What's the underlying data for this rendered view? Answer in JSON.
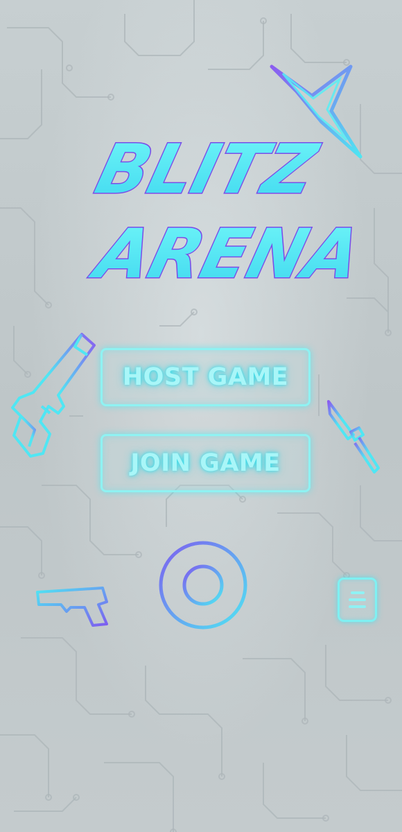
{
  "title": {
    "line1": "BLITZ",
    "line2": "ARENA"
  },
  "menu": {
    "host_label": "HOST GAME",
    "join_label": "JOIN GAME"
  },
  "icons": {
    "shuriken": "shuriken-icon",
    "pistol_large": "pistol-icon",
    "knife": "knife-icon",
    "crosshair": "crosshair-icon",
    "pistol_small": "pistol-icon",
    "menu": "menu-icon"
  },
  "colors": {
    "background": "#c2c9cb",
    "neon_cyan": "#5ff0f5",
    "neon_purple": "#8a5cf0",
    "circuit_lines": "#aeb7ba"
  }
}
